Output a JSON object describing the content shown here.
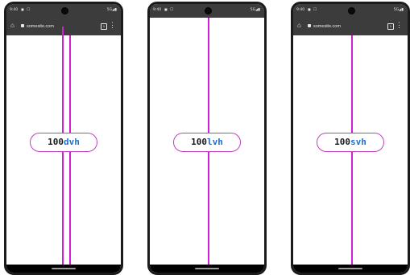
{
  "phones": [
    {
      "status_time": "9:40",
      "status_icons_left": "◼ ☐",
      "status_icons_right": "5G◢▮",
      "url": "somesite.com",
      "value": "100",
      "unit": "dvh",
      "show_address_bar": true
    },
    {
      "status_time": "9:40",
      "status_icons_left": "◼ ☐",
      "status_icons_right": "5G◢▮",
      "url": "",
      "value": "100",
      "unit": "lvh",
      "show_address_bar": false
    },
    {
      "status_time": "9:40",
      "status_icons_left": "◼ ☐",
      "status_icons_right": "5G◢▮",
      "url": "somesite.com",
      "value": "100",
      "unit": "svh",
      "show_address_bar": true
    }
  ],
  "colors": {
    "line": "#d020d0",
    "unit": "#1a6fd6",
    "pill_border": "#c040c0",
    "chrome_bar": "#3c3c3c"
  },
  "icons": {
    "home": "home-icon",
    "lock": "lock-icon",
    "tabs": "tabs-icon",
    "menu": "menu-icon"
  },
  "tabs_count": "1"
}
